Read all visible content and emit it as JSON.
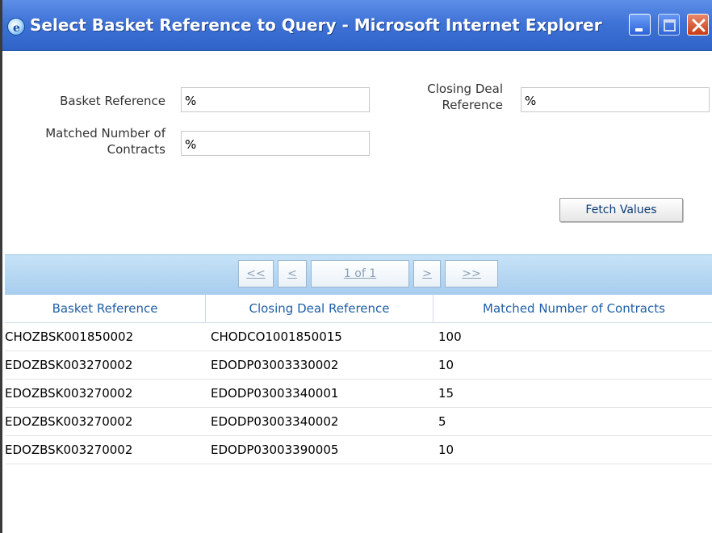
{
  "window": {
    "title": "Select Basket Reference to Query - Microsoft Internet Explorer",
    "icon": "ie-icon",
    "controls": [
      "minimize-icon",
      "maximize-icon",
      "close-icon"
    ]
  },
  "form": {
    "basket_reference_label": "Basket Reference",
    "basket_reference_value": "%",
    "closing_deal_label_line1": "Closing Deal",
    "closing_deal_label_line2": "Reference",
    "closing_deal_value": "%",
    "matched_label_line1": "Matched Number of",
    "matched_label_line2": "Contracts",
    "matched_value": "%",
    "fetch_button_label": "Fetch Values"
  },
  "pager": {
    "first": "<<",
    "prev": "<",
    "page": "1 of 1",
    "next": ">",
    "last": ">>"
  },
  "table": {
    "columns": [
      "Basket Reference",
      "Closing Deal Reference",
      "Matched Number of Contracts"
    ],
    "rows": [
      [
        "CHOZBSK001850002",
        "CHODCO1001850015",
        "100"
      ],
      [
        "EDOZBSK003270002",
        "EDODP03003330002",
        "10"
      ],
      [
        "EDOZBSK003270002",
        "EDODP03003340001",
        "15"
      ],
      [
        "EDOZBSK003270002",
        "EDODP03003340002",
        "5"
      ],
      [
        "EDOZBSK003270002",
        "EDODP03003390005",
        "10"
      ]
    ]
  },
  "colors": {
    "titlebar": "#3f73d6",
    "header_band": "#b7d8f2",
    "column_header_text": "#1f5fa6"
  }
}
